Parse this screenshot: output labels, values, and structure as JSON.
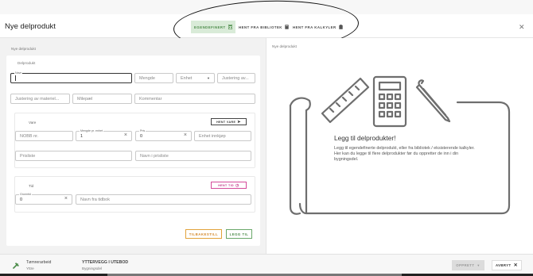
{
  "header": {
    "title": "Nye delprodukt",
    "tabs": [
      {
        "label": "EGENDEFINERT",
        "icon": "calculator-icon",
        "active": true
      },
      {
        "label": "HENT FRA BIBLIOTEK",
        "icon": "book-icon",
        "active": false
      },
      {
        "label": "HENT FRA KALKYLER",
        "icon": "clipboard-icon",
        "active": false
      }
    ],
    "close_icon": "close-icon"
  },
  "left": {
    "section_label": "Nye delprodukt",
    "card_title": "Delprodukt",
    "fields": {
      "navn": {
        "label": "Navn",
        "value": ""
      },
      "mengde": {
        "placeholder": "Mengde"
      },
      "enhet": {
        "placeholder": "Enhet"
      },
      "justering1": {
        "placeholder": "Justering av..."
      },
      "justering2": {
        "placeholder": "Justering av materiel..."
      },
      "milepael": {
        "placeholder": "Milepæl"
      },
      "kommentar": {
        "placeholder": "Kommentar"
      }
    },
    "vare": {
      "title": "Vare",
      "button": "HENT VARE",
      "nobb": {
        "placeholder": "NOBB nr."
      },
      "mengde_per_enhet": {
        "label": "Mengde pr. enhet",
        "value": "1"
      },
      "pris": {
        "label": "Pris",
        "value": "0"
      },
      "enhet_innkjop": {
        "placeholder": "Enhet innkjøp"
      },
      "prisliste": {
        "placeholder": "Prisliste"
      },
      "navn_prisliste": {
        "placeholder": "Navn i prisliste"
      }
    },
    "tid": {
      "title": "Tid",
      "button": "HENT TID",
      "grunntid": {
        "label": "Grunntid",
        "value": "0"
      },
      "navn_tidbok": {
        "placeholder": "Navn fra tidbok"
      }
    },
    "buttons": {
      "reset": "TILBAKESTILL",
      "add": "LEGG TIL"
    }
  },
  "right": {
    "section_label": "Nye delprodukt",
    "empty_title": "Legg til delprodukter!",
    "empty_desc": "Legg til egendefinerte delprodukt, eller fra bibliotek / eksisterende kalkyler. Her kan du legge til flere delprodukter før du oppretter de inn i din bygningsdel."
  },
  "footer": {
    "category": "Tømrerarbeid",
    "category_sub": "Yttre",
    "part": "YTTERVEGG I UTEBOD",
    "part_sub": "Bygningsdel",
    "create": "OPPRETT",
    "cancel": "AVBRYT"
  },
  "colors": {
    "accent_green": "#4c8c4a",
    "accent_orange": "#d4892a",
    "accent_pink": "#c2398a"
  }
}
